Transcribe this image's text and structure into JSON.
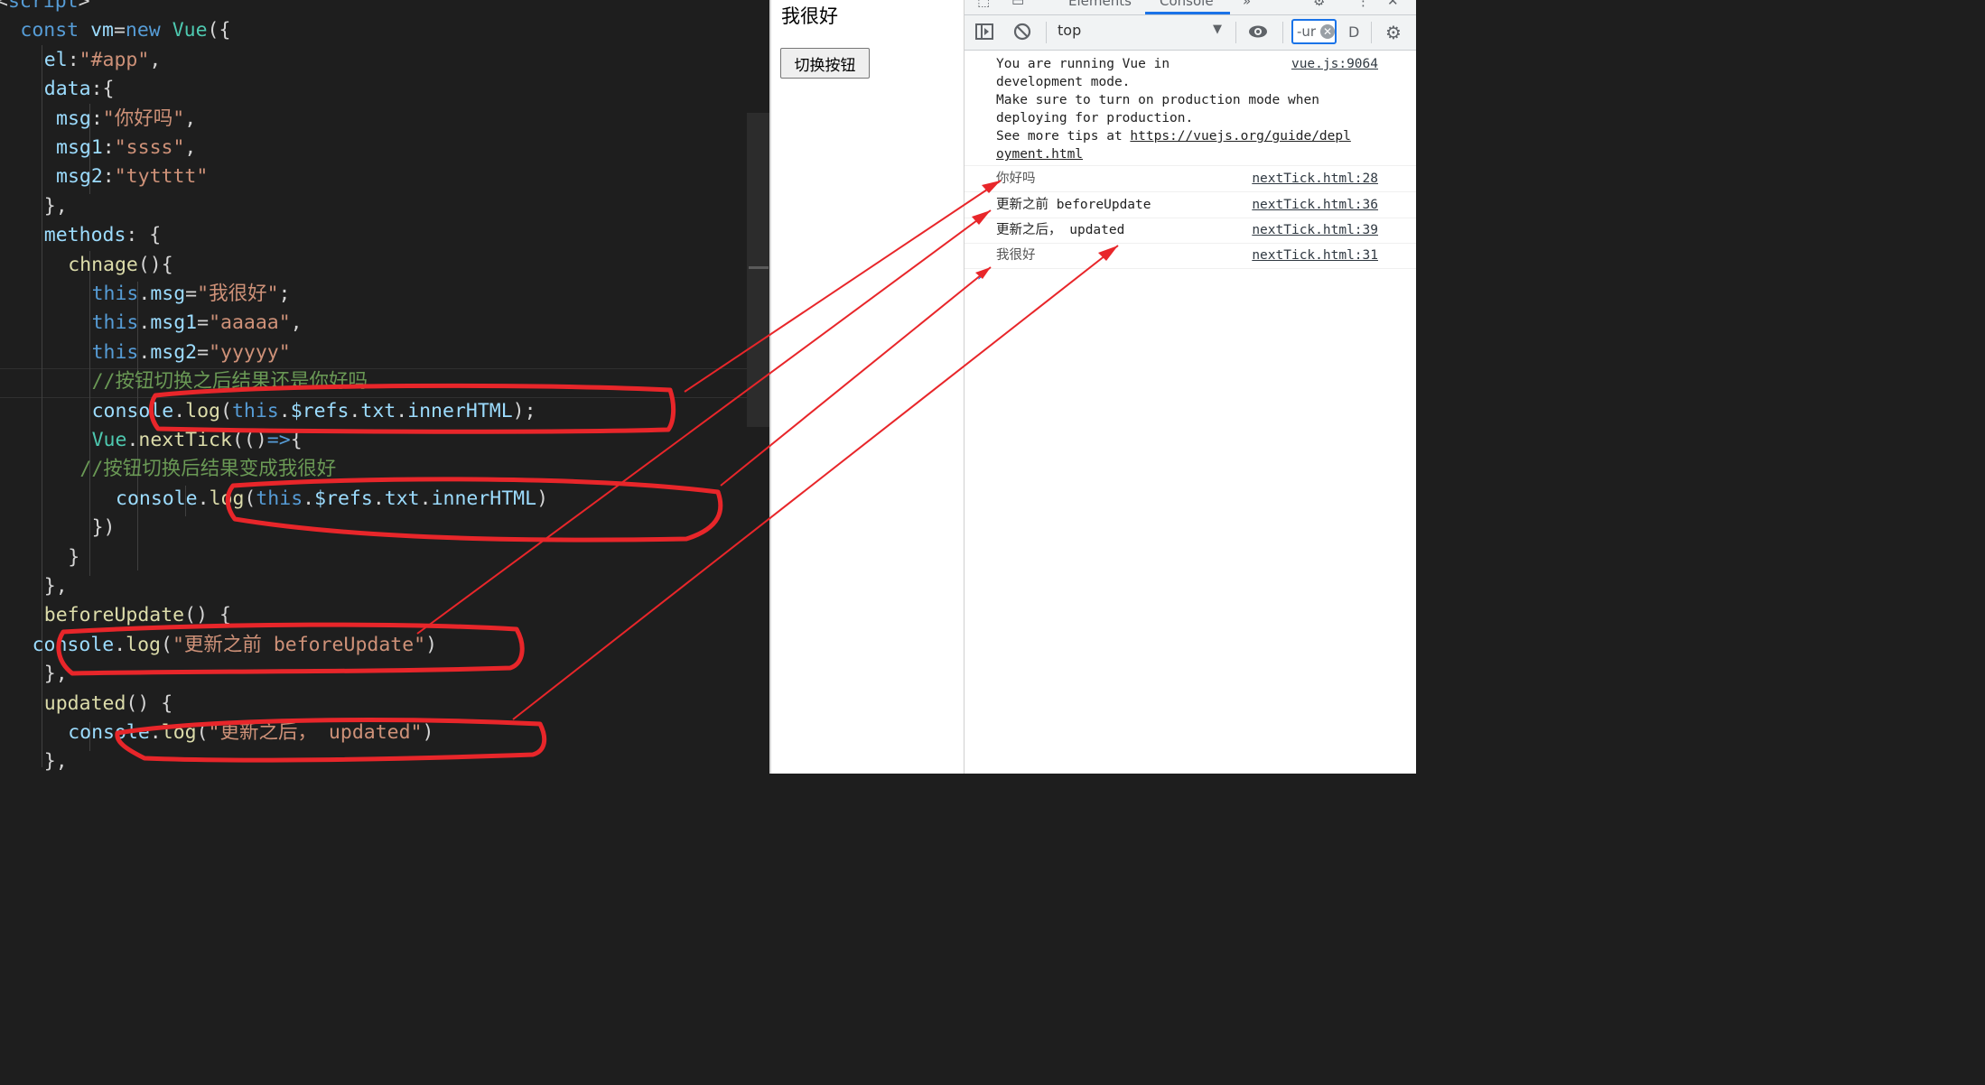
{
  "editor": {
    "lines": [
      {
        "indent": 0,
        "tokens": [
          [
            "pun",
            "<"
          ],
          [
            "kw",
            "script"
          ],
          [
            "pun",
            ">"
          ]
        ]
      },
      {
        "indent": 2,
        "tokens": [
          [
            "kw",
            "const "
          ],
          [
            "var",
            "vm"
          ],
          [
            "pun",
            "="
          ],
          [
            "kw",
            "new "
          ],
          [
            "cls",
            "Vue"
          ],
          [
            "pun",
            "({"
          ]
        ]
      },
      {
        "indent": 4,
        "tokens": [
          [
            "var",
            "el"
          ],
          [
            "pun",
            ":"
          ],
          [
            "str",
            "\"#app\""
          ],
          [
            "pun",
            ","
          ]
        ]
      },
      {
        "indent": 4,
        "tokens": [
          [
            "var",
            "data"
          ],
          [
            "pun",
            ":{"
          ]
        ]
      },
      {
        "indent": 5,
        "tokens": [
          [
            "var",
            "msg"
          ],
          [
            "pun",
            ":"
          ],
          [
            "str",
            "\"你好吗\""
          ],
          [
            "pun",
            ","
          ]
        ]
      },
      {
        "indent": 5,
        "tokens": [
          [
            "var",
            "msg1"
          ],
          [
            "pun",
            ":"
          ],
          [
            "str",
            "\"ssss\""
          ],
          [
            "pun",
            ","
          ]
        ]
      },
      {
        "indent": 5,
        "tokens": [
          [
            "var",
            "msg2"
          ],
          [
            "pun",
            ":"
          ],
          [
            "str",
            "\"tytttt\""
          ]
        ]
      },
      {
        "indent": 4,
        "tokens": [
          [
            "pun",
            "},"
          ]
        ]
      },
      {
        "indent": 4,
        "tokens": [
          [
            "var",
            "methods"
          ],
          [
            "pun",
            ": {"
          ]
        ]
      },
      {
        "indent": 6,
        "tokens": [
          [
            "fn",
            "chnage"
          ],
          [
            "pun",
            "(){"
          ]
        ]
      },
      {
        "indent": 8,
        "tokens": [
          [
            "kw",
            "this"
          ],
          [
            "pun",
            "."
          ],
          [
            "var",
            "msg"
          ],
          [
            "pun",
            "="
          ],
          [
            "str",
            "\"我很好\""
          ],
          [
            "pun",
            ";"
          ]
        ]
      },
      {
        "indent": 8,
        "tokens": [
          [
            "kw",
            "this"
          ],
          [
            "pun",
            "."
          ],
          [
            "var",
            "msg1"
          ],
          [
            "pun",
            "="
          ],
          [
            "str",
            "\"aaaaa\""
          ],
          [
            "pun",
            ","
          ]
        ]
      },
      {
        "indent": 8,
        "tokens": [
          [
            "kw",
            "this"
          ],
          [
            "pun",
            "."
          ],
          [
            "var",
            "msg2"
          ],
          [
            "pun",
            "="
          ],
          [
            "str",
            "\"yyyyy\""
          ]
        ]
      },
      {
        "indent": 8,
        "tokens": [
          [
            "cm",
            "//按钮切换之后结果还是你好吗"
          ]
        ]
      },
      {
        "indent": 8,
        "tokens": [
          [
            "var",
            "console"
          ],
          [
            "pun",
            "."
          ],
          [
            "fn",
            "log"
          ],
          [
            "pun",
            "("
          ],
          [
            "kw",
            "this"
          ],
          [
            "pun",
            "."
          ],
          [
            "var",
            "$refs"
          ],
          [
            "pun",
            "."
          ],
          [
            "var",
            "txt"
          ],
          [
            "pun",
            "."
          ],
          [
            "var",
            "innerHTML"
          ],
          [
            "pun",
            ");"
          ]
        ]
      },
      {
        "indent": 8,
        "tokens": [
          [
            "cls",
            "Vue"
          ],
          [
            "pun",
            "."
          ],
          [
            "fn",
            "nextTick"
          ],
          [
            "pun",
            "(()"
          ],
          [
            "kw",
            "=>"
          ],
          [
            "pun",
            "{"
          ]
        ]
      },
      {
        "indent": 7,
        "tokens": [
          [
            "cm",
            "//按钮切换后结果变成我很好"
          ]
        ]
      },
      {
        "indent": 10,
        "tokens": [
          [
            "var",
            "console"
          ],
          [
            "pun",
            "."
          ],
          [
            "fn",
            "log"
          ],
          [
            "pun",
            "("
          ],
          [
            "kw",
            "this"
          ],
          [
            "pun",
            "."
          ],
          [
            "var",
            "$refs"
          ],
          [
            "pun",
            "."
          ],
          [
            "var",
            "txt"
          ],
          [
            "pun",
            "."
          ],
          [
            "var",
            "innerHTML"
          ],
          [
            "pun",
            ")"
          ]
        ]
      },
      {
        "indent": 8,
        "tokens": [
          [
            "pun",
            "})"
          ]
        ]
      },
      {
        "indent": 6,
        "tokens": [
          [
            "pun",
            "}"
          ]
        ]
      },
      {
        "indent": 4,
        "tokens": [
          [
            "pun",
            "},"
          ]
        ]
      },
      {
        "indent": 4,
        "tokens": [
          [
            "fn",
            "beforeUpdate"
          ],
          [
            "pun",
            "() {"
          ]
        ]
      },
      {
        "indent": 3,
        "tokens": [
          [
            "var",
            "console"
          ],
          [
            "pun",
            "."
          ],
          [
            "fn",
            "log"
          ],
          [
            "pun",
            "("
          ],
          [
            "str",
            "\"更新之前 beforeUpdate\""
          ],
          [
            "pun",
            ")"
          ]
        ]
      },
      {
        "indent": 4,
        "tokens": [
          [
            "pun",
            "},"
          ]
        ]
      },
      {
        "indent": 4,
        "tokens": [
          [
            "fn",
            "updated"
          ],
          [
            "pun",
            "() {"
          ]
        ]
      },
      {
        "indent": 6,
        "tokens": [
          [
            "var",
            "console"
          ],
          [
            "pun",
            "."
          ],
          [
            "fn",
            "log"
          ],
          [
            "pun",
            "("
          ],
          [
            "str",
            "\"更新之后， updated\""
          ],
          [
            "pun",
            ")"
          ]
        ]
      },
      {
        "indent": 4,
        "tokens": [
          [
            "pun",
            "},"
          ]
        ]
      }
    ]
  },
  "page": {
    "text": "我很好",
    "button_label": "切换按钮"
  },
  "devtools": {
    "tabs": [
      "Elements",
      "Console",
      "»"
    ],
    "context": "top",
    "filter_value": "-ur",
    "levels_label": "D",
    "messages": [
      {
        "text": "You are running Vue in\ndevelopment mode.\nMake sure to turn on production mode when\ndeploying for production.\nSee more tips at ",
        "link": "https://vuejs.org/guide/depl\noyment.html",
        "source": "vue.js:9064"
      },
      {
        "text": "你好吗",
        "source": "nextTick.html:28"
      },
      {
        "text": "更新之前 beforeUpdate",
        "source": "nextTick.html:36"
      },
      {
        "text": "更新之后， updated",
        "source": "nextTick.html:39"
      },
      {
        "text": "我很好",
        "source": "nextTick.html:31"
      }
    ],
    "prompt": "›"
  },
  "colors": {
    "annotation_red": "#e8262a",
    "devtools_accent": "#1a73e8"
  }
}
